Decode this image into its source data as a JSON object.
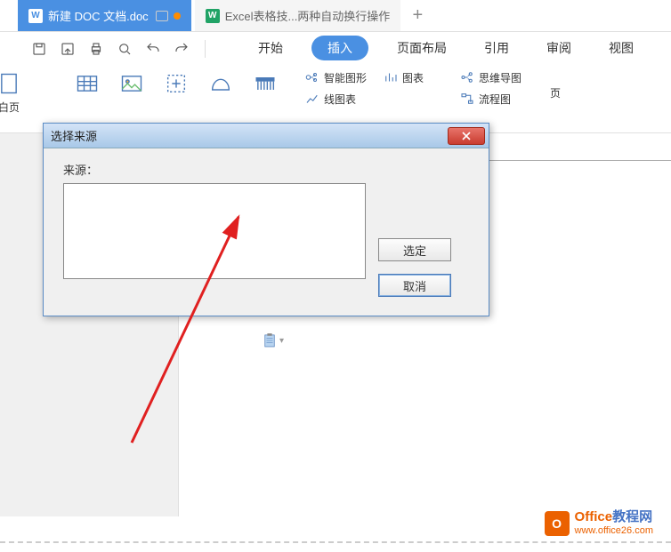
{
  "tabs": {
    "active": {
      "icon": "W",
      "label": "新建 DOC 文档.doc"
    },
    "inactive": {
      "icon": "W",
      "label": "Excel表格技...两种自动换行操作"
    }
  },
  "menu": {
    "start": "开始",
    "insert": "插入",
    "layout": "页面布局",
    "reference": "引用",
    "review": "审阅",
    "view": "视图"
  },
  "ribbon": {
    "page_label": "白页",
    "smart_shape": "智能图形",
    "chart": "图表",
    "online_chart": "线图表",
    "mindmap": "思维导图",
    "flowchart": "流程图",
    "page_more": "页"
  },
  "dialog": {
    "title": "选择来源",
    "label": "来源：",
    "select_btn": "选定",
    "cancel_btn": "取消"
  },
  "watermark": {
    "title_part1": "Office",
    "title_part2": "教程网",
    "url": "www.office26.com",
    "icon_text": "O"
  }
}
